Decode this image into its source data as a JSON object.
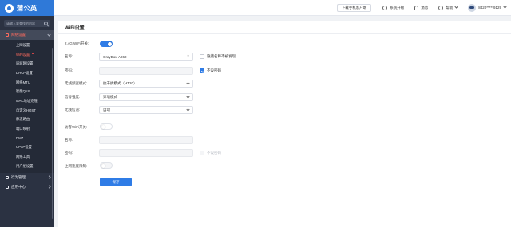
{
  "app": {
    "brand": "蒲公英"
  },
  "sidebar": {
    "search_placeholder": "请输入要查找的内容",
    "group_network": "网络设置",
    "items": [
      {
        "label": "上网设置"
      },
      {
        "label": "WiFi设置"
      },
      {
        "label": "局域网设置"
      },
      {
        "label": "DHCP设置"
      },
      {
        "label": "网络MTU"
      },
      {
        "label": "智能QoS"
      },
      {
        "label": "MAC地址克隆"
      },
      {
        "label": "自定义HOST"
      },
      {
        "label": "静态路由"
      },
      {
        "label": "端口映射"
      },
      {
        "label": "DMZ"
      },
      {
        "label": "UPnP设置"
      },
      {
        "label": "网络工具"
      },
      {
        "label": "用户组设置"
      }
    ],
    "group_behavior": "行为管理",
    "group_apps": "应用中心"
  },
  "topbar": {
    "download": "下载手机客户端",
    "upgrade": "系统升级",
    "messages": "消息",
    "help": "帮助",
    "user": "8420*****9129"
  },
  "page": {
    "title": "WiFi设置",
    "wifi24": {
      "toggle_label": "2.4G WiFi开关:",
      "enabled": true,
      "name_label": "名称:",
      "name_value": "OrayBox-A060",
      "hide_name_label": "隐藏名称不被发现",
      "hide_name_checked": false,
      "password_label": "密码:",
      "password_value": "",
      "no_password_label": "不设密码",
      "no_password_checked": true,
      "mode_label": "无线频宽模式:",
      "mode_value": "抗干扰模式（HT20）",
      "signal_label": "信号强度:",
      "signal_value": "穿墙模式",
      "channel_label": "无线信道:",
      "channel_value": "自动"
    },
    "guest": {
      "toggle_label": "访客WiFi开关:",
      "enabled": false,
      "name_label": "名称:",
      "password_label": "密码:",
      "no_password_label": "不设密码",
      "speed_limit_label": "上网速度限制:"
    },
    "save_label": "保存"
  },
  "colors": {
    "accent": "#2f7ce6",
    "sidebar_bg": "#2b3242",
    "active_text": "#ff6b5e",
    "brand": "#2f79d8"
  }
}
